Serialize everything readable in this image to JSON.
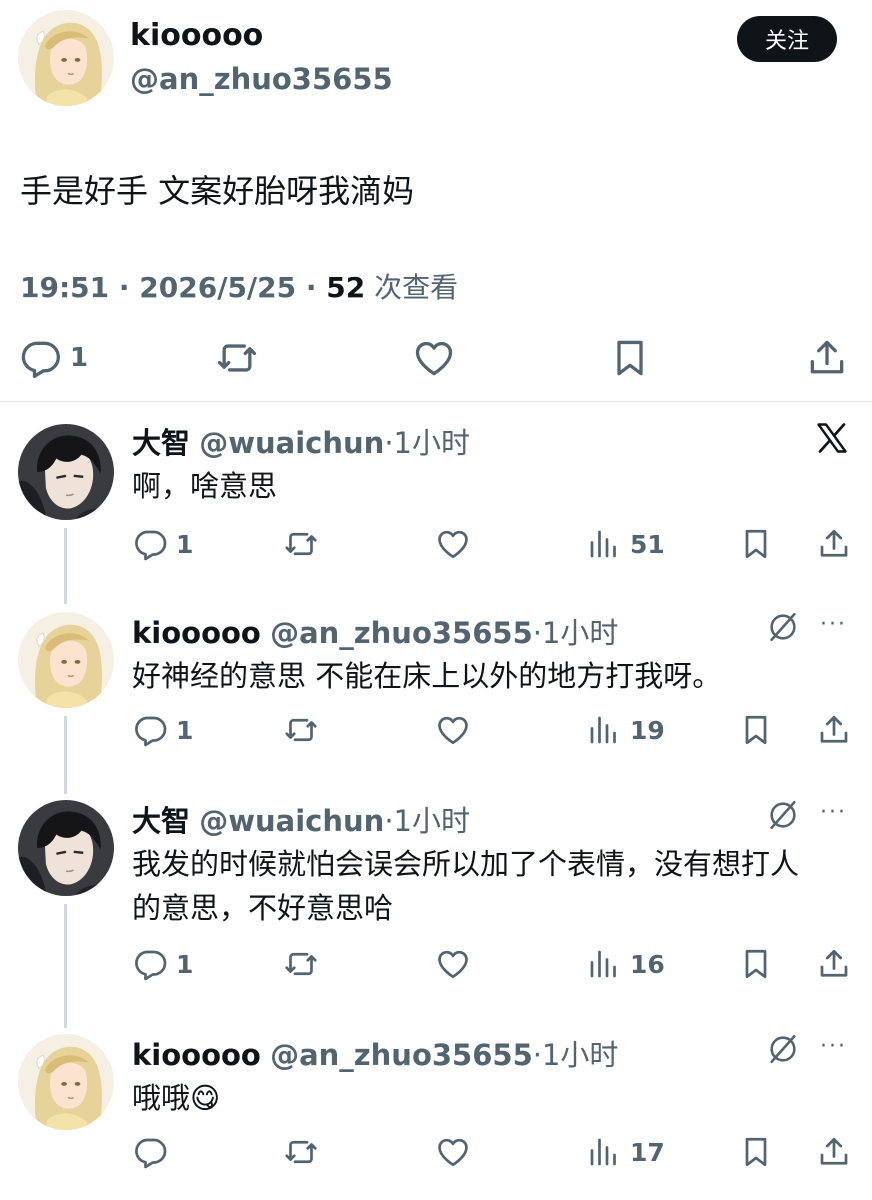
{
  "main": {
    "name": "kiooooo",
    "handle": "@an_zhuo35655",
    "follow_label": "关注",
    "text": "手是好手 文案好胎呀我滴妈",
    "time": "19:51",
    "sep1": " · ",
    "date": "2026/5/25",
    "sep2": " · ",
    "views": "52",
    "views_label": " 次查看",
    "reply_count": "1"
  },
  "replies": [
    {
      "name": "大智",
      "handle": "@wuaichun",
      "time": "·1小时",
      "text": "啊，啥意思",
      "reply_count": "1",
      "views": "51"
    },
    {
      "name": "kiooooo",
      "handle": "@an_zhuo35655",
      "time": "·1小时",
      "text": "好神经的意思 不能在床上以外的地方打我呀。",
      "reply_count": "1",
      "views": "19"
    },
    {
      "name": "大智",
      "handle": "@wuaichun",
      "time": "·1小时",
      "text": "我发的时候就怕会误会所以加了个表情，没有想打人的意思，不好意思哈",
      "reply_count": "1",
      "views": "16"
    },
    {
      "name": "kiooooo",
      "handle": "@an_zhuo35655",
      "time": "·1小时",
      "text": "哦哦",
      "emoji": "😋",
      "reply_count": "",
      "views": "17"
    }
  ],
  "icons": {
    "reply": "reply-icon",
    "retweet": "retweet-icon",
    "like": "heart-icon",
    "bookmark": "bookmark-icon",
    "share": "share-icon",
    "views": "views-icon",
    "grok": "grok-icon",
    "more": "more-icon",
    "x_logo": "x-logo"
  },
  "colors": {
    "text": "#0f1419",
    "secondary": "#536471",
    "follow_bg": "#0f1419",
    "thread_line": "#cfd9de"
  }
}
